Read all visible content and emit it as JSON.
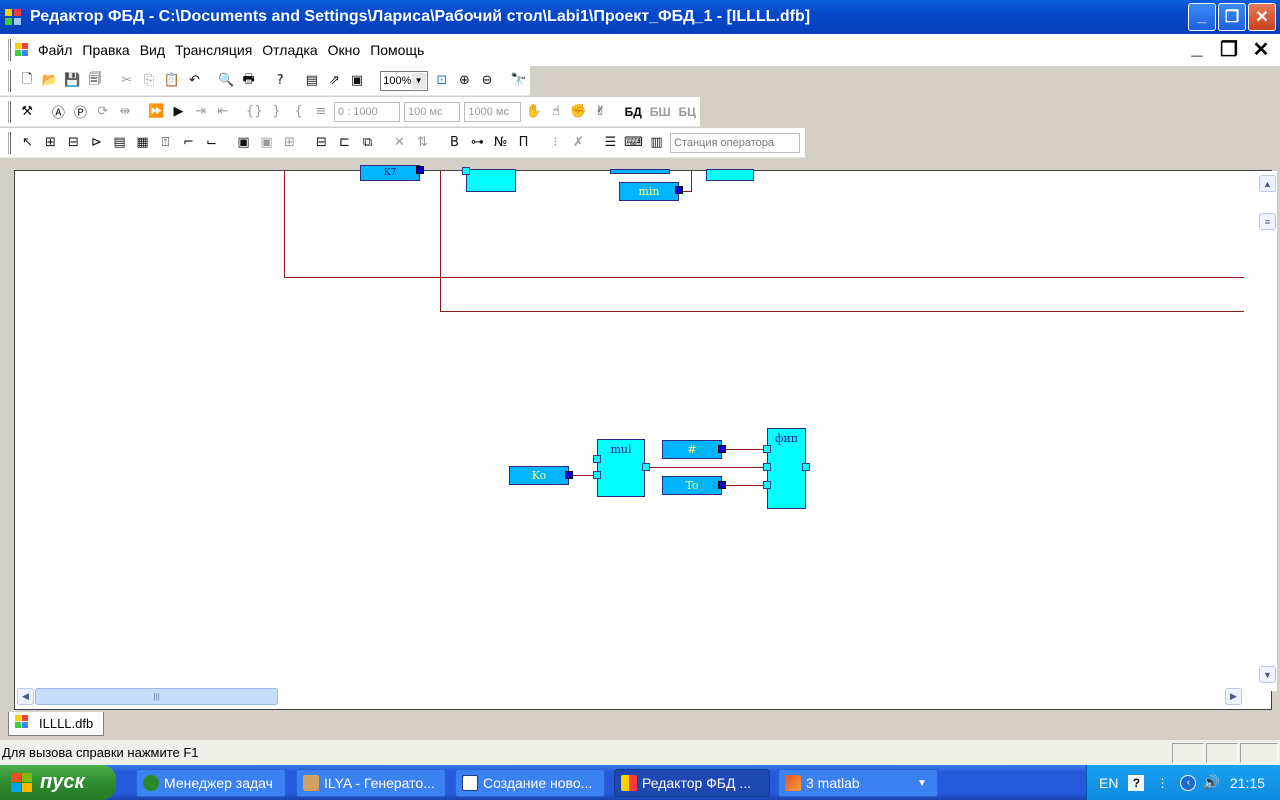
{
  "window": {
    "title": "Редактор ФБД - C:\\Documents and Settings\\Лариса\\Рабочий стол\\Labi1\\Проект_ФБД_1 - [ILLLL.dfb]"
  },
  "menu": [
    "Файл",
    "Правка",
    "Вид",
    "Трансляция",
    "Отладка",
    "Окно",
    "Помощь"
  ],
  "toolbar1": {
    "zoom_value": "100%",
    "buttons": [
      "new-icon",
      "open-icon",
      "save-icon",
      "save-all-icon",
      "cut-icon",
      "copy-icon",
      "paste-icon",
      "undo-icon",
      "print-preview-icon",
      "print-icon",
      "help-icon",
      "properties-icon",
      "link-icon",
      "window-icon",
      "fit-icon",
      "zoom-in-icon",
      "zoom-out-icon",
      "find-icon"
    ]
  },
  "toolbar2": {
    "time_range": "0 : 1000",
    "step": "100 мс",
    "period": "1000 мс",
    "labels": [
      "БД",
      "БШ",
      "БЦ"
    ]
  },
  "toolbar3": {
    "station_placeholder": "Станция оператора"
  },
  "diagram": {
    "blocks": [
      {
        "name": "mul",
        "label": "mul"
      },
      {
        "name": "fip",
        "label": "фип"
      }
    ],
    "variables": {
      "min": "min",
      "ko": "Ko",
      "hash": "#",
      "to": "To",
      "top_clipped": "K7"
    },
    "wire_color": "#8b1a1a",
    "block_color": "#00ffff",
    "variable_color": "#00b4ff"
  },
  "tabs": [
    "ILLLL.dfb"
  ],
  "status": {
    "text": "Для вызова справки нажмите F1"
  },
  "taskbar": {
    "start_label": "пуск",
    "tasks": [
      {
        "label": "Менеджер задач",
        "active": false
      },
      {
        "label": "ILYA - Генерато...",
        "active": false
      },
      {
        "label": "Создание ново...",
        "active": false
      },
      {
        "label": "Редактор ФБД ...",
        "active": true
      },
      {
        "label": "3 matlab",
        "active": false
      }
    ],
    "language": "EN",
    "clock": "21:15"
  }
}
